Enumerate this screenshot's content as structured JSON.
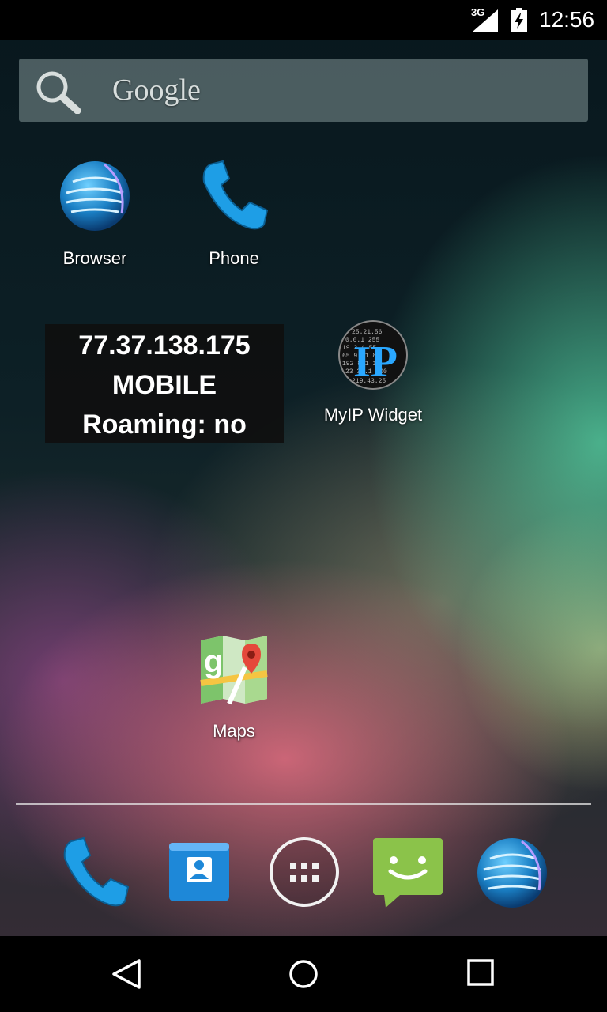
{
  "status_bar": {
    "network_type": "3G",
    "time": "12:56",
    "icons": [
      "signal-icon",
      "battery-icon"
    ]
  },
  "search": {
    "label": "Google",
    "icon": "search-icon"
  },
  "home_apps": [
    {
      "label": "Browser",
      "icon": "globe-icon"
    },
    {
      "label": "Phone",
      "icon": "phone-icon"
    },
    {
      "label": "MyIP Widget",
      "icon": "myip-icon"
    },
    {
      "label": "Maps",
      "icon": "maps-icon"
    }
  ],
  "ip_widget": {
    "ip": "77.37.138.175",
    "connection": "MOBILE",
    "roaming": "Roaming: no"
  },
  "dock": [
    {
      "name": "phone",
      "icon": "phone-icon"
    },
    {
      "name": "contacts",
      "icon": "contacts-icon"
    },
    {
      "name": "app-drawer",
      "icon": "app-drawer-icon"
    },
    {
      "name": "messaging",
      "icon": "messaging-icon"
    },
    {
      "name": "browser",
      "icon": "globe-icon"
    }
  ],
  "navigation": [
    "back-icon",
    "home-icon",
    "recents-icon"
  ],
  "colors": {
    "accent_blue": "#1e9ee6",
    "message_green": "#8bc34a",
    "widget_bg": "#0f0f0f"
  }
}
